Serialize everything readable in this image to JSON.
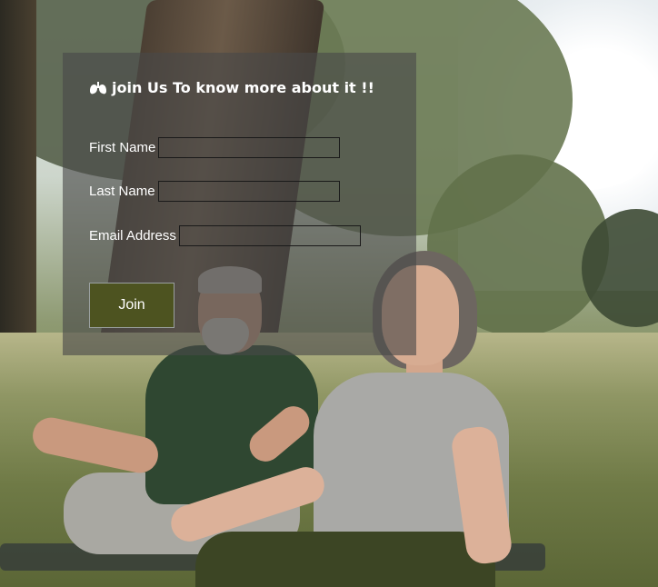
{
  "form": {
    "title": "join Us To know more about it !!",
    "title_icon": "lungs-icon",
    "fields": [
      {
        "label": "First Name",
        "value": ""
      },
      {
        "label": "Last Name",
        "value": ""
      },
      {
        "label": "Email Address",
        "value": ""
      }
    ],
    "submit_label": "Join"
  },
  "colors": {
    "panel_overlay": "#484848",
    "button_bg": "#4d5320",
    "text": "#ffffff"
  }
}
